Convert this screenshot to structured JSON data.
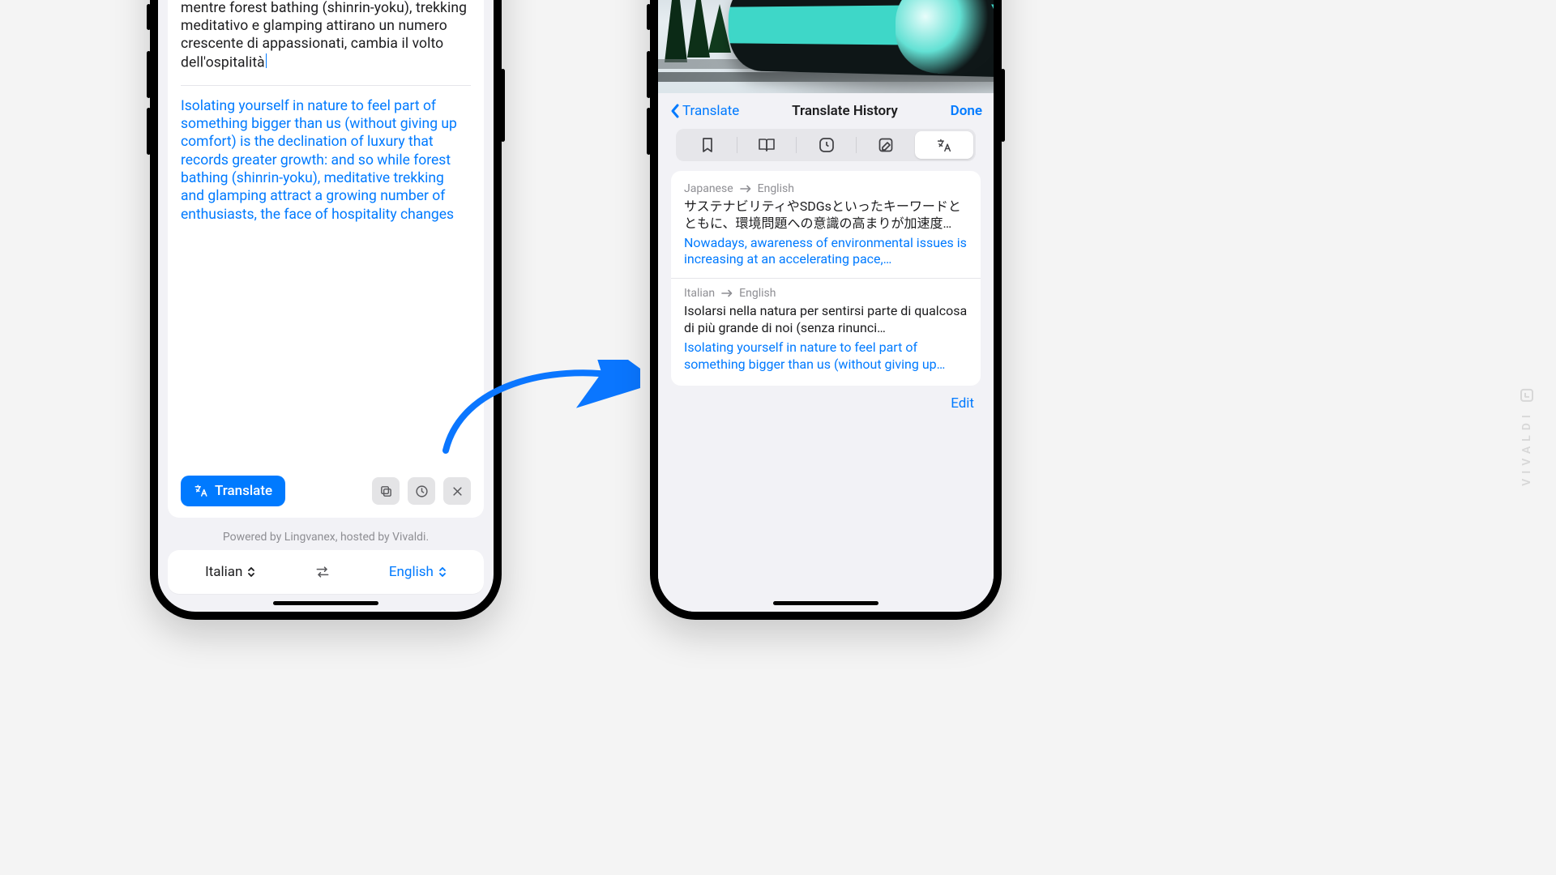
{
  "colors": {
    "accent": "#007aff"
  },
  "left": {
    "source_text": "Isolarsi nella natura per sentirsi parte di qualcosa di più grande di noi (senza rinunciare al comfort) è la declinazione del lusso che registra maggiori crescite: e così mentre forest bathing (shinrin-yoku), trekking meditativo e glamping attirano un numero crescente di appassionati, cambia il volto dell'ospitalità",
    "target_text": "Isolating yourself in nature to feel part of something bigger than us (without giving up comfort) is the declination of luxury that records greater growth: and so while forest bathing (shinrin-yoku), meditative trekking and glamping attract a growing number of enthusiasts, the face of hospitality changes",
    "translate_label": "Translate",
    "powered": "Powered by Lingvanex, hosted by Vivaldi.",
    "lang_from": "Italian",
    "lang_to": "English"
  },
  "right": {
    "back_label": "Translate",
    "title": "Translate History",
    "done": "Done",
    "edit": "Edit",
    "history": [
      {
        "from": "Japanese",
        "to": "English",
        "src": "サステナビリティやSDGsといったキーワードとともに、環境問題への意識の高まりが加速度…",
        "tgt": "Nowadays, awareness of environmental issues is increasing at an accelerating pace,…"
      },
      {
        "from": "Italian",
        "to": "English",
        "src": "Isolarsi nella natura per sentirsi parte di qualcosa di più grande di noi (senza rinunci…",
        "tgt": "Isolating yourself in nature to feel part of something bigger than us (without giving up…"
      }
    ]
  },
  "brand": "VIVALDI"
}
